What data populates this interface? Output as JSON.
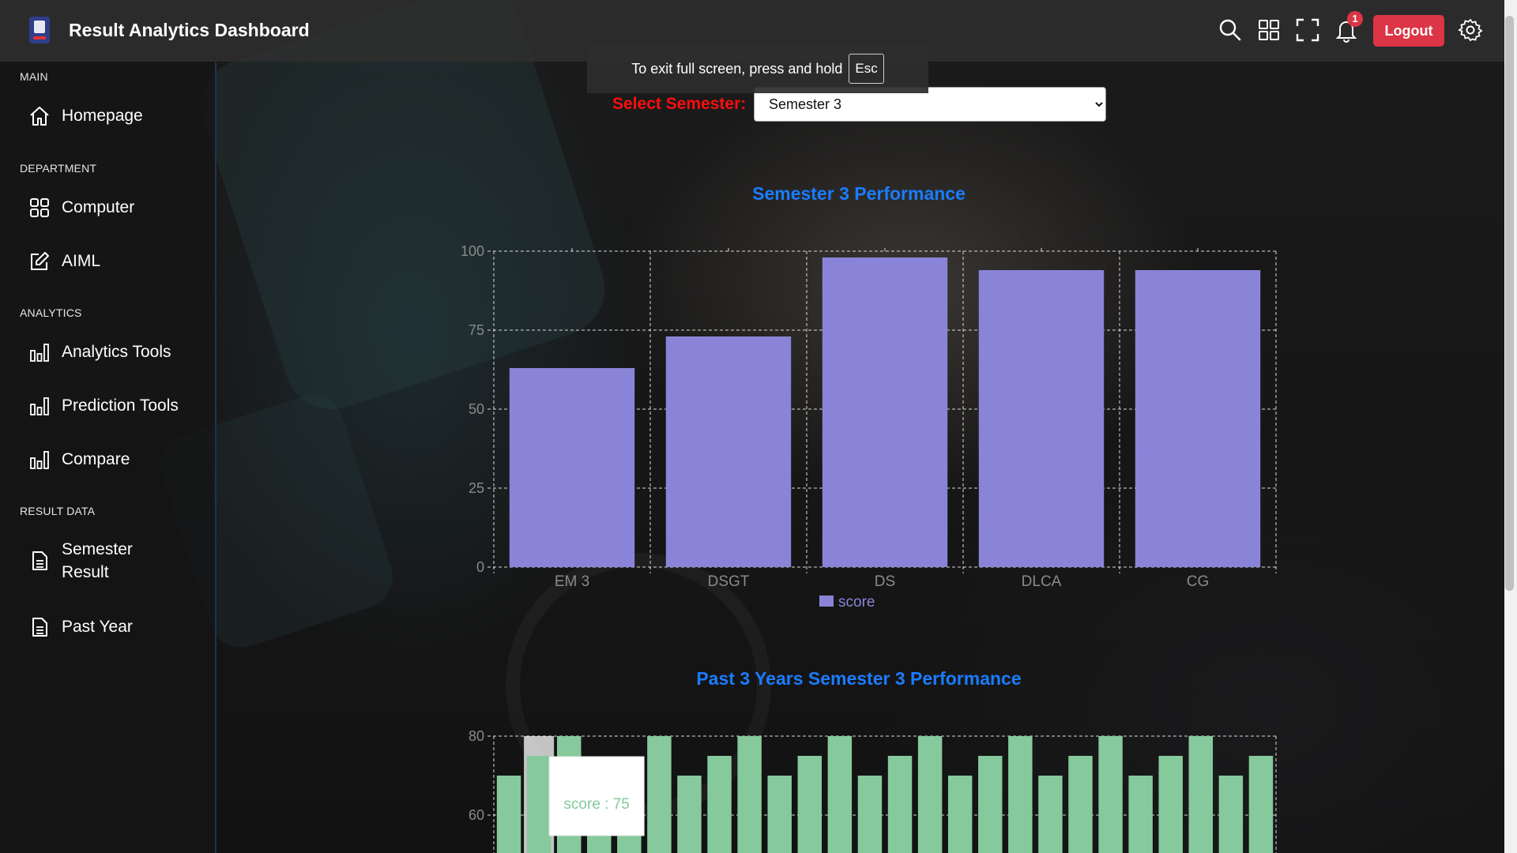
{
  "header": {
    "title": "Result Analytics Dashboard",
    "logout_label": "Logout",
    "notification_count": "1",
    "icons": [
      "search-icon",
      "grid-icon",
      "fullscreen-icon",
      "bell-icon",
      "gear-icon"
    ]
  },
  "fullscreen_toast": {
    "text": "To exit full screen, press and hold",
    "key": "Esc"
  },
  "sidebar": {
    "sections": [
      {
        "label": "MAIN",
        "items": [
          {
            "label": "Homepage",
            "icon": "home-icon"
          }
        ]
      },
      {
        "label": "DEPARTMENT",
        "items": [
          {
            "label": "Computer",
            "icon": "grid-icon"
          },
          {
            "label": "AIML",
            "icon": "edit-icon"
          }
        ]
      },
      {
        "label": "ANALYTICS",
        "items": [
          {
            "label": "Analytics Tools",
            "icon": "bar-chart-icon"
          },
          {
            "label": "Prediction Tools",
            "icon": "bar-chart-icon"
          },
          {
            "label": "Compare",
            "icon": "bar-chart-icon"
          }
        ]
      },
      {
        "label": "RESULT DATA",
        "items": [
          {
            "label": "Semester Result",
            "icon": "document-icon"
          },
          {
            "label": "Past Year",
            "icon": "document-icon"
          }
        ]
      }
    ]
  },
  "semester_select": {
    "label": "Select Semester:",
    "value": "Semester 3"
  },
  "colors": {
    "accent": "#1a7cff",
    "logout": "#dc3545",
    "bar_purple": "#8a84d8",
    "bar_green": "#86c99c",
    "label_red": "#ff0d0d"
  },
  "chart_data": [
    {
      "type": "bar",
      "title": "Semester 3 Performance",
      "categories": [
        "EM 3",
        "DSGT",
        "DS",
        "DLCA",
        "CG"
      ],
      "series": [
        {
          "name": "score",
          "values": [
            63,
            73,
            98,
            94,
            94
          ]
        }
      ],
      "ylim": [
        0,
        100
      ],
      "yticks": [
        0,
        25,
        50,
        75,
        100
      ],
      "grid": true,
      "legend": "bottom"
    },
    {
      "type": "bar",
      "title": "Past 3 Years Semester 3 Performance",
      "series": [
        {
          "name": "score",
          "values": [
            70,
            75,
            80,
            70,
            70,
            80,
            70,
            75,
            80,
            70,
            75,
            80,
            70,
            75,
            80,
            70,
            75,
            80,
            70,
            75,
            80,
            70,
            75,
            80,
            70,
            75
          ]
        }
      ],
      "ylim_visible": [
        60,
        80
      ],
      "yticks_visible": [
        60,
        80
      ],
      "grid": true,
      "tooltip": "score : 75"
    }
  ]
}
